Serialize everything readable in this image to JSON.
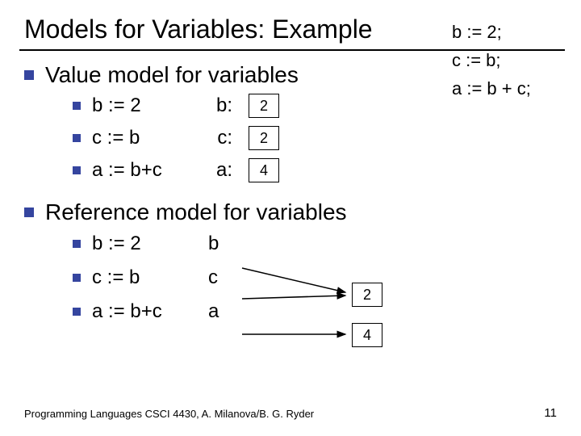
{
  "title": "Models for Variables: Example",
  "code_side": {
    "line1": "b := 2;",
    "line2": "c := b;",
    "line3": "a := b + c;"
  },
  "section1": {
    "heading": "Value model for variables",
    "rows": [
      {
        "assign": "b := 2",
        "var": "b:",
        "val": "2"
      },
      {
        "assign": "c := b",
        "var": "c:",
        "val": "2"
      },
      {
        "assign": "a := b+c",
        "var": "a:",
        "val": "4"
      }
    ]
  },
  "section2": {
    "heading": "Reference model for variables",
    "rows": [
      {
        "assign": "b := 2",
        "var": "b"
      },
      {
        "assign": "c := b",
        "var": "c"
      },
      {
        "assign": "a := b+c",
        "var": "a"
      }
    ],
    "boxes": {
      "top": "2",
      "bottom": "4"
    }
  },
  "footer": "Programming Languages CSCI 4430, A. Milanova/B. G. Ryder",
  "page": "11"
}
